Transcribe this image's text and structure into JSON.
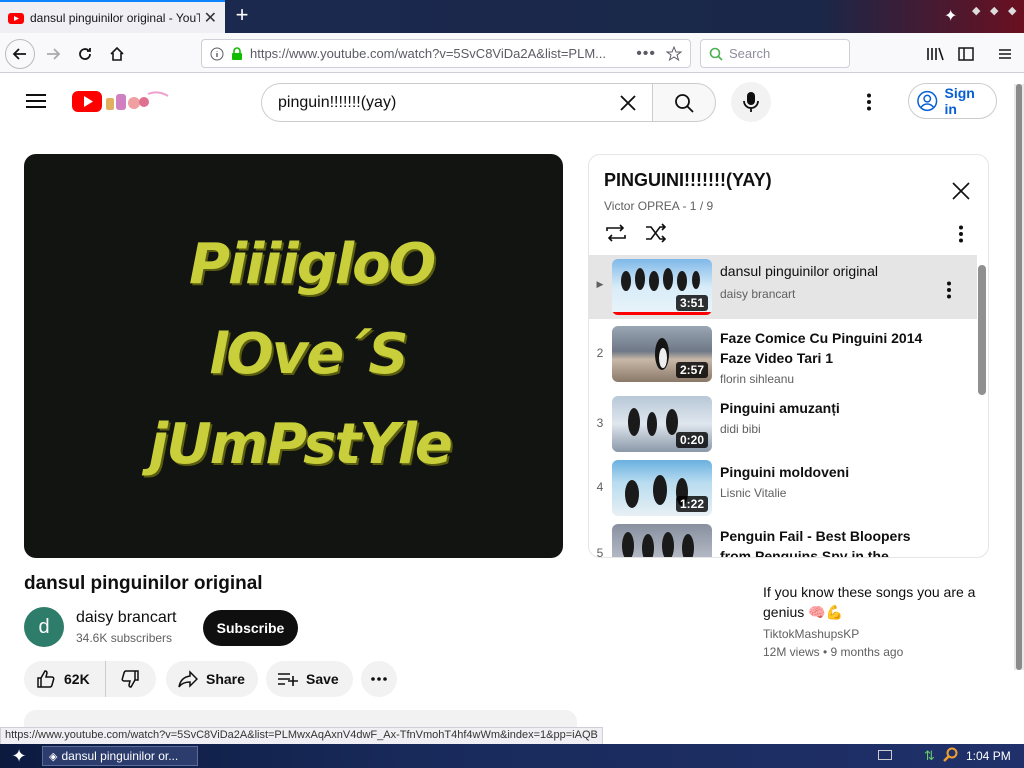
{
  "browser": {
    "tab_title": "dansul pinguinilor original - YouTube",
    "url": "https://www.youtube.com/watch?v=5SvC8ViDa2A&list=PLM...",
    "search_placeholder": "Search",
    "status_url": "https://www.youtube.com/watch?v=5SvC8ViDa2A&list=PLMwxAqAxnV4dwF_Ax-TfnVmohT4hf4wWm&index=1&pp=iAQB"
  },
  "yt": {
    "search_query": "pinguin!!!!!!!(yay)",
    "sign_in": "Sign in"
  },
  "video": {
    "overlay_lines": [
      "PiiiigloO",
      "lOve´S",
      "jUmPstYle"
    ],
    "title": "dansul pinguinilor original",
    "channel": "daisy brancart",
    "channel_initial": "d",
    "subscribers": "34.6K subscribers",
    "subscribe": "Subscribe",
    "likes": "62K",
    "share": "Share",
    "save": "Save"
  },
  "playlist": {
    "title": "PINGUINI!!!!!!!(YAY)",
    "subtitle": "Victor OPREA - 1 / 9",
    "items": [
      {
        "num": "▶",
        "title": "dansul pinguinilor original",
        "channel": "daisy brancart",
        "duration": "3:51"
      },
      {
        "num": "2",
        "title": "Faze Comice Cu Pinguini 2014 Faze Video Tari 1",
        "channel": "florin sihleanu",
        "duration": "2:57"
      },
      {
        "num": "3",
        "title": "Pinguini amuzanți",
        "channel": "didi bibi",
        "duration": "0:20"
      },
      {
        "num": "4",
        "title": "Pinguini moldoveni",
        "channel": "Lisnic Vitalie",
        "duration": "1:22"
      },
      {
        "num": "5",
        "title": "Penguin Fail - Best Bloopers from Penguins Spy in the",
        "channel": "",
        "duration": ""
      }
    ]
  },
  "recommendation": {
    "title": "If you know these songs you are a genius 🧠💪",
    "channel": "TiktokMashupsKP",
    "meta": "12M views • 9 months ago"
  },
  "taskbar": {
    "task": "dansul pinguinilor or...",
    "clock": "1:04 PM"
  },
  "colors": {
    "yt_red": "#ff0000",
    "link_blue": "#065fd4",
    "video_text": "#c8cf3a"
  }
}
